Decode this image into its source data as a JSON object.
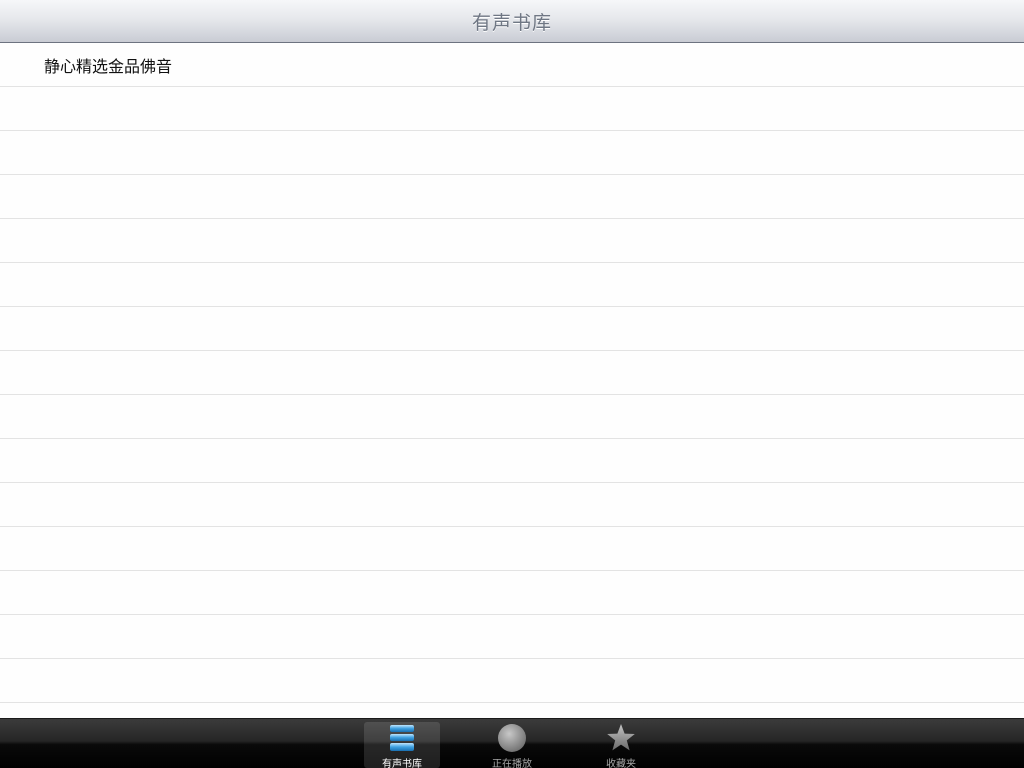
{
  "navbar": {
    "title": "有声书库"
  },
  "list": {
    "items": [
      {
        "label": "静心精选金品佛音"
      }
    ]
  },
  "tabbar": {
    "tabs": [
      {
        "label": "有声书库",
        "icon": "library-stack-icon",
        "selected": true
      },
      {
        "label": "正在播放",
        "icon": "now-playing-disc-icon",
        "selected": false
      },
      {
        "label": "收藏夹",
        "icon": "star-icon",
        "selected": false
      }
    ]
  },
  "colors": {
    "navbar_title": "#6f7784",
    "row_separator": "#e3e3e3",
    "tab_selected_icon": "#3ea0e0"
  }
}
